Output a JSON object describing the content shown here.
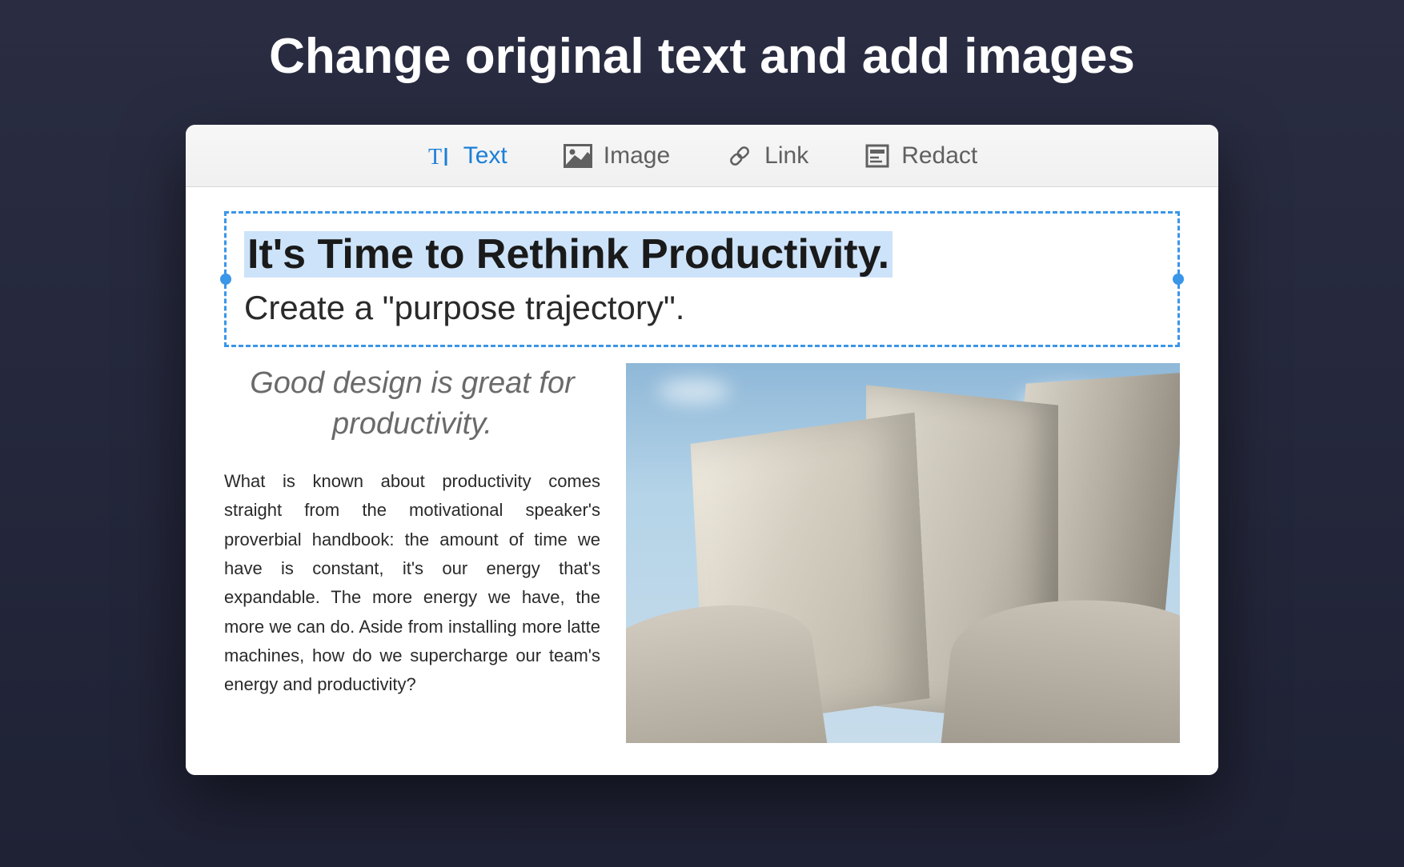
{
  "headline": "Change original text and add images",
  "toolbar": {
    "items": [
      {
        "label": "Text",
        "active": true
      },
      {
        "label": "Image",
        "active": false
      },
      {
        "label": "Link",
        "active": false
      },
      {
        "label": "Redact",
        "active": false
      }
    ]
  },
  "document": {
    "title": "It's Time to Rethink Productivity.",
    "subtitle": "Create a \"purpose trajectory\".",
    "quote": "Good design is great for productivity.",
    "body": "What is known about productivity comes straight from the motivational speaker's proverbial handbook: the amount of time we have is constant, it's our energy that's expandable. The more energy we have, the more we can do. Aside from installing more latte machines, how do we supercharge our team's energy and productivity?"
  },
  "colors": {
    "accent": "#1b7fd8",
    "selection_border": "#3a96e8",
    "highlight": "#cde3f9"
  }
}
